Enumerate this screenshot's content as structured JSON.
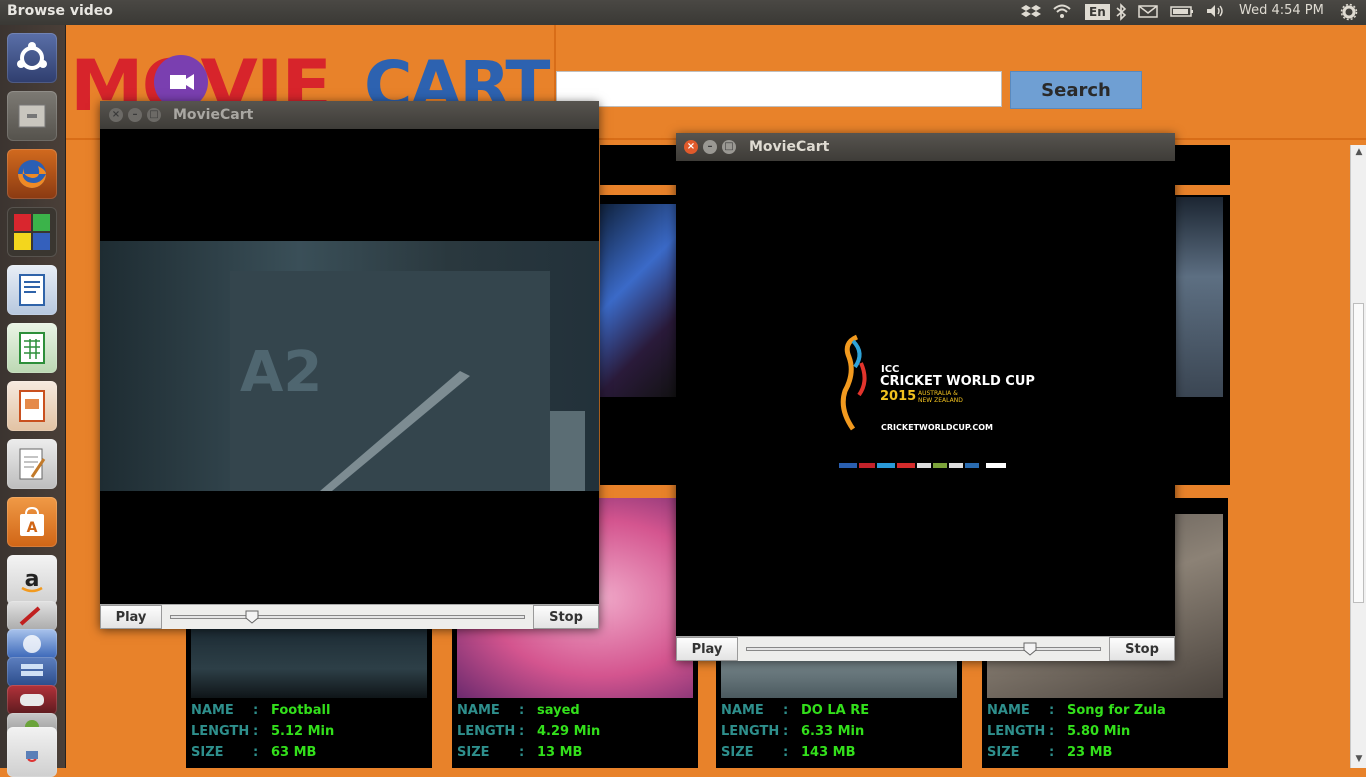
{
  "topbar": {
    "app_title": "Browse video",
    "lang": "En",
    "clock": "Wed  4:54 PM"
  },
  "launcher": {
    "items": [
      "ubuntu-dash",
      "files",
      "firefox",
      "app-grid",
      "libreoffice-writer",
      "libreoffice-calc",
      "libreoffice-impress",
      "text-editor",
      "software-center",
      "amazon",
      "tool",
      "app",
      "stack",
      "app2",
      "java"
    ]
  },
  "app": {
    "logo_movie": "MOVIE",
    "logo_cart": "CART",
    "search_placeholder": "",
    "search_label": "Search"
  },
  "cards": [
    {
      "name_key": "NAME",
      "length_key": "LENGTH",
      "size_key": "SIZE",
      "name": "Football",
      "length": "5.12 Min",
      "size": "63 MB"
    },
    {
      "name_key": "NAME",
      "length_key": "LENGTH",
      "size_key": "SIZE",
      "name": "sayed",
      "length": "4.29 Min",
      "size": "13 MB"
    },
    {
      "name_key": "NAME",
      "length_key": "LENGTH",
      "size_key": "SIZE",
      "name": "DO LA RE",
      "length": "6.33 Min",
      "size": "143 MB"
    },
    {
      "name_key": "NAME",
      "length_key": "LENGTH",
      "size_key": "SIZE",
      "name": "Song for Zula",
      "length": "5.80 Min",
      "size": "23 MB"
    }
  ],
  "player1": {
    "title": "MovieCart",
    "play_label": "Play",
    "stop_label": "Stop",
    "progress": 0.23
  },
  "player2": {
    "title": "MovieCart",
    "play_label": "Play",
    "stop_label": "Stop",
    "progress": 0.8,
    "poster": {
      "icc": "ICC",
      "line1": "CRICKET WORLD CUP",
      "year": "2015",
      "hosts1": "AUSTRALIA &",
      "hosts2": "NEW ZEALAND",
      "url": "CRICKETWORLDCUP.COM"
    }
  },
  "colors": {
    "orange": "#e8822a",
    "search_btn": "#6f9fd3",
    "label_teal": "#2e8f8c",
    "value_green": "#33e01b"
  }
}
